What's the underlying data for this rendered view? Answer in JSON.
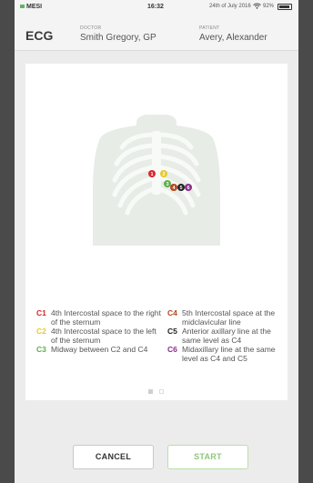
{
  "status_bar": {
    "carrier": "MESI",
    "time": "16:32",
    "date": "24th of July 2016",
    "battery_text": "92%",
    "battery_level": 0.92
  },
  "header": {
    "title": "ECG",
    "doctor_label": "DOCTOR",
    "doctor_name": "Smith Gregory, GP",
    "patient_label": "PATIENT",
    "patient_name": "Avery, Alexander"
  },
  "electrodes": [
    {
      "code": "1",
      "color": "#d9262b"
    },
    {
      "code": "2",
      "color": "#e8c92a"
    },
    {
      "code": "3",
      "color": "#5ab04a"
    },
    {
      "code": "4",
      "color": "#b5471d"
    },
    {
      "code": "5",
      "color": "#222222"
    },
    {
      "code": "6",
      "color": "#8a2d8a"
    }
  ],
  "legend": {
    "left": [
      {
        "code": "C1",
        "text": "4th Intercostal space to the right of the sternum",
        "color": "#d9262b"
      },
      {
        "code": "C2",
        "text": "4th Intercostal space to the left of the sternum",
        "color": "#e8c92a"
      },
      {
        "code": "C3",
        "text": "Midway between C2 and C4",
        "color": "#5ab04a"
      }
    ],
    "right": [
      {
        "code": "C4",
        "text": "5th Intercostal space at the midclavicular line",
        "color": "#b5471d"
      },
      {
        "code": "C5",
        "text": "Anterior axillary line at the same level as C4",
        "color": "#222222"
      },
      {
        "code": "C6",
        "text": "Midaxillary line at the same level as C4 and C5",
        "color": "#8a2d8a"
      }
    ]
  },
  "pager": {
    "current": 1,
    "total": 2
  },
  "buttons": {
    "cancel": "CANCEL",
    "start": "START"
  }
}
